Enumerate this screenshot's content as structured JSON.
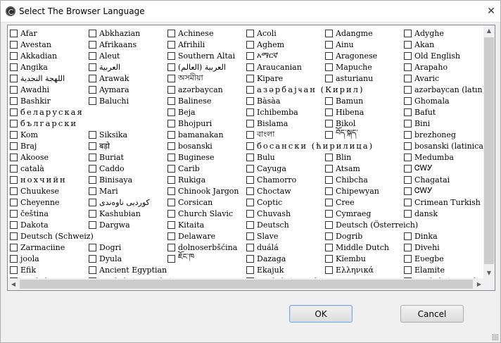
{
  "window": {
    "title": "Select The Browser Language",
    "close_symbol": "✕"
  },
  "languages": [
    [
      "Afar",
      "Abkhazian",
      "Achinese",
      "Acoli",
      "Adangme",
      "Adyghe"
    ],
    [
      "Avestan",
      "Afrikaans",
      "Afrihili",
      "Aghem",
      "Ainu",
      "Akan"
    ],
    [
      "Akkadian",
      "Aleut",
      "Southern Altai",
      "አማርኛ",
      "Aragonese",
      "Old English"
    ],
    [
      "Angika",
      "العربية",
      "العربية (العالم)",
      "Araucanian",
      "Mapuche",
      "Arapaho"
    ],
    [
      "اللهجة النجدية",
      "Arawak",
      "অসমীয়া",
      "Kipare",
      "asturianu",
      "Avaric"
    ],
    [
      "Awadhi",
      "Aymara",
      "azərbaycan",
      "азәрбајҹан (Кирил)",
      "",
      "azərbaycan (latın)"
    ],
    [
      "Bashkir",
      "Baluchi",
      "Balinese",
      "Bàsàa",
      "Bamun",
      "Ghomala"
    ],
    [
      "беларуская",
      "",
      "Beja",
      "Ichibemba",
      "Hibena",
      "Bafut"
    ],
    [
      "български",
      "",
      "Bhojpuri",
      "Bislama",
      "Bikol",
      "Bini"
    ],
    [
      "Kom",
      "Siksika",
      "bamanakan",
      "বাংলা",
      "བོད་སྐད་",
      "brezhoneg"
    ],
    [
      "Braj",
      "बड़ो",
      "bosanski",
      "босански (ћирилица)",
      "",
      "bosanski (latinica)"
    ],
    [
      "Akoose",
      "Buriat",
      "Buginese",
      "Bulu",
      "Blin",
      "Medumba"
    ],
    [
      "català",
      "Caddo",
      "Carib",
      "Cayuga",
      "Atsam",
      "ᏣᎳᎩ"
    ],
    [
      "нохчийн",
      "Binisaya",
      "Rukiga",
      "Chamorro",
      "Chibcha",
      "Chagatai"
    ],
    [
      "Chuukese",
      "Mari",
      "Chinook Jargon",
      "Choctaw",
      "Chipewyan",
      "ᏣᎳᎩ"
    ],
    [
      "Cheyenne",
      "کوردیی ناوەندی",
      "Corsican",
      "Coptic",
      "Cree",
      "Crimean Turkish"
    ],
    [
      "čeština",
      "Kashubian",
      "Church Slavic",
      "Chuvash",
      "Cymraeg",
      "dansk"
    ],
    [
      "Dakota",
      "Dargwa",
      "Kitaita",
      "Deutsch",
      "Deutsch (Österreich)",
      ""
    ],
    [
      "Deutsch (Schweiz)",
      "",
      "Delaware",
      "Slave",
      "Dogrib",
      "Dinka"
    ],
    [
      "Zarmaciine",
      "Dogri",
      "dolnoserbšćina",
      "duálá",
      "Middle Dutch",
      "Divehi"
    ],
    [
      "joola",
      "Dyula",
      "ཇོང་ཁ",
      "Dazaga",
      "Kĩembu",
      "Eʋegbe"
    ],
    [
      "Efik",
      "Ancient Egyptian",
      "",
      "Ekajuk",
      "Ελληνικά",
      "Elamite"
    ],
    [
      "English",
      "English (Australia)",
      "",
      "English (Canada)",
      "",
      "English (United Kingdom)"
    ]
  ],
  "no_checkbox": [
    [
      5,
      4
    ],
    [
      7,
      1
    ],
    [
      8,
      1
    ],
    [
      10,
      4
    ],
    [
      17,
      5
    ],
    [
      18,
      1
    ],
    [
      21,
      2
    ],
    [
      22,
      2
    ],
    [
      22,
      4
    ]
  ],
  "buttons": {
    "ok": "OK",
    "cancel": "Cancel"
  },
  "scroll_glyphs": {
    "up": "▲",
    "down": "▼",
    "left": "◀",
    "right": "▶"
  }
}
